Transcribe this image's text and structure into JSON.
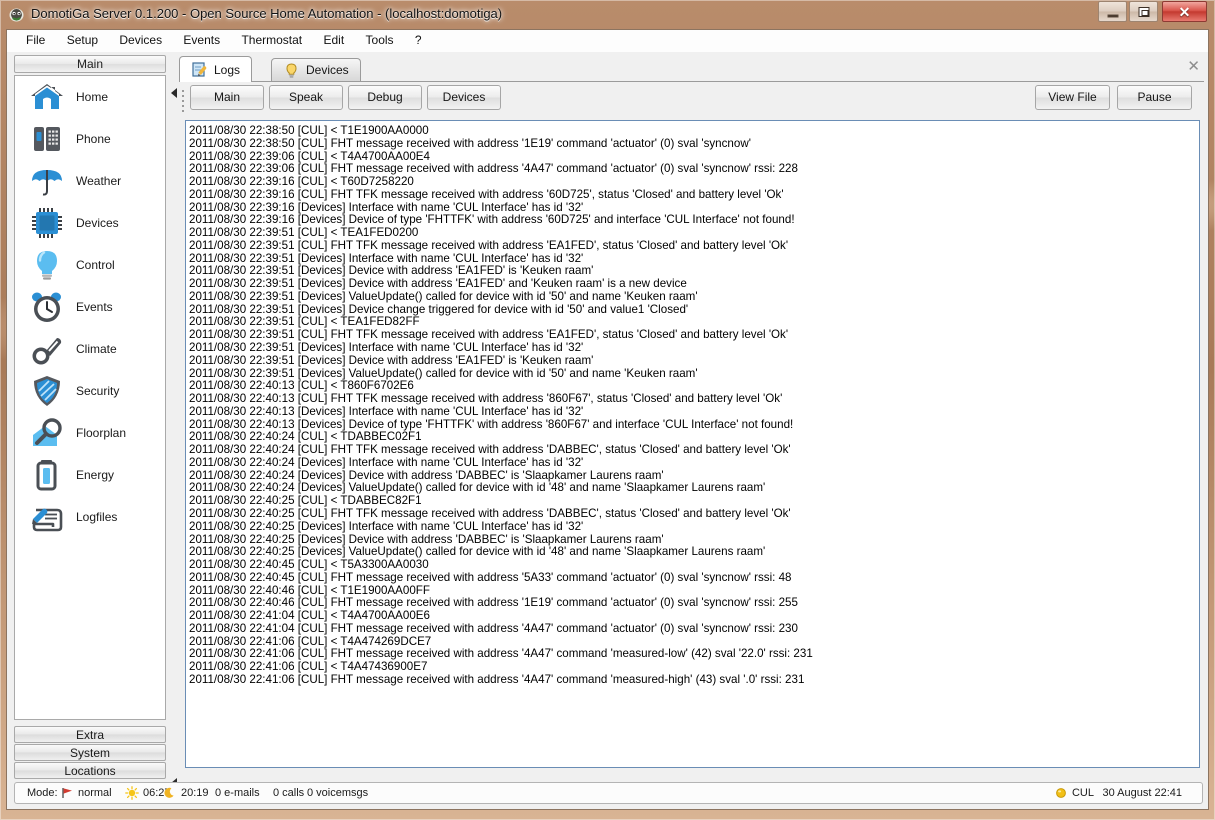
{
  "window": {
    "title": "DomotiGa Server 0.1.200 - Open Source Home Automation - (localhost:domotiga)",
    "icon": "domotiga-app-icon",
    "controls": {
      "minimize": "minimize",
      "maximize": "maximize",
      "close": "✕"
    },
    "accent_close": "#c33a30",
    "titlebar_color": "#a87a58"
  },
  "menubar": {
    "items": [
      {
        "label": "File"
      },
      {
        "label": "Setup"
      },
      {
        "label": "Devices"
      },
      {
        "label": "Events"
      },
      {
        "label": "Thermostat"
      },
      {
        "label": "Edit"
      },
      {
        "label": "Tools"
      },
      {
        "label": "?"
      }
    ]
  },
  "sidebar": {
    "header": "Main",
    "items": [
      {
        "label": "Home",
        "icon": "house-icon"
      },
      {
        "label": "Phone",
        "icon": "phone-icon"
      },
      {
        "label": "Weather",
        "icon": "umbrella-icon"
      },
      {
        "label": "Devices",
        "icon": "chip-icon"
      },
      {
        "label": "Control",
        "icon": "lightbulb-icon"
      },
      {
        "label": "Events",
        "icon": "alarm-clock-icon"
      },
      {
        "label": "Climate",
        "icon": "thermometer-icon"
      },
      {
        "label": "Security",
        "icon": "shield-icon"
      },
      {
        "label": "Floorplan",
        "icon": "house-magnifier-icon"
      },
      {
        "label": "Energy",
        "icon": "battery-icon"
      },
      {
        "label": "Logfiles",
        "icon": "scroll-pencil-icon"
      }
    ],
    "footer_buttons": [
      {
        "label": "Extra"
      },
      {
        "label": "System"
      },
      {
        "label": "Locations"
      }
    ]
  },
  "main": {
    "tabs": [
      {
        "label": "Logs",
        "icon": "notepad-pencil-icon",
        "active": true
      },
      {
        "label": "Devices",
        "icon": "lightbulb-icon",
        "active": false
      }
    ],
    "close_tab_label": "✕",
    "toolbar": {
      "left_buttons": [
        {
          "label": "Main"
        },
        {
          "label": "Speak"
        },
        {
          "label": "Debug"
        },
        {
          "label": "Devices"
        }
      ],
      "right_buttons": [
        {
          "label": "View File"
        },
        {
          "label": "Pause"
        }
      ]
    },
    "log_lines": [
      "2011/08/30 22:38:50 [CUL] < T1E1900AA0000",
      "2011/08/30 22:38:50 [CUL] FHT message received with address '1E19' command 'actuator' (0) sval 'syncnow'",
      "2011/08/30 22:39:06 [CUL] < T4A4700AA00E4",
      "2011/08/30 22:39:06 [CUL] FHT message received with address '4A47' command 'actuator' (0) sval 'syncnow' rssi: 228",
      "2011/08/30 22:39:16 [CUL] < T60D7258220",
      "2011/08/30 22:39:16 [CUL] FHT TFK message received with address '60D725', status 'Closed' and battery level 'Ok'",
      "2011/08/30 22:39:16 [Devices] Interface with name 'CUL Interface' has id '32'",
      "2011/08/30 22:39:16 [Devices] Device of type 'FHTTFK' with address '60D725' and interface 'CUL Interface' not found!",
      "2011/08/30 22:39:51 [CUL] < TEA1FED0200",
      "2011/08/30 22:39:51 [CUL] FHT TFK message received with address 'EA1FED', status 'Closed' and battery level 'Ok'",
      "2011/08/30 22:39:51 [Devices] Interface with name 'CUL Interface' has id '32'",
      "2011/08/30 22:39:51 [Devices] Device with address 'EA1FED' is 'Keuken raam'",
      "2011/08/30 22:39:51 [Devices] Device with address 'EA1FED' and 'Keuken raam' is a new device",
      "2011/08/30 22:39:51 [Devices] ValueUpdate() called for device with id '50' and name 'Keuken raam'",
      "2011/08/30 22:39:51 [Devices] Device change triggered for device with id '50' and value1 'Closed'",
      "2011/08/30 22:39:51 [CUL] < TEA1FED82FF",
      "2011/08/30 22:39:51 [CUL] FHT TFK message received with address 'EA1FED', status 'Closed' and battery level 'Ok'",
      "2011/08/30 22:39:51 [Devices] Interface with name 'CUL Interface' has id '32'",
      "2011/08/30 22:39:51 [Devices] Device with address 'EA1FED' is 'Keuken raam'",
      "2011/08/30 22:39:51 [Devices] ValueUpdate() called for device with id '50' and name 'Keuken raam'",
      "2011/08/30 22:40:13 [CUL] < T860F6702E6",
      "2011/08/30 22:40:13 [CUL] FHT TFK message received with address '860F67', status 'Closed' and battery level 'Ok'",
      "2011/08/30 22:40:13 [Devices] Interface with name 'CUL Interface' has id '32'",
      "2011/08/30 22:40:13 [Devices] Device of type 'FHTTFK' with address '860F67' and interface 'CUL Interface' not found!",
      "2011/08/30 22:40:24 [CUL] < TDABBEC02F1",
      "2011/08/30 22:40:24 [CUL] FHT TFK message received with address 'DABBEC', status 'Closed' and battery level 'Ok'",
      "2011/08/30 22:40:24 [Devices] Interface with name 'CUL Interface' has id '32'",
      "2011/08/30 22:40:24 [Devices] Device with address 'DABBEC' is 'Slaapkamer Laurens raam'",
      "2011/08/30 22:40:24 [Devices] ValueUpdate() called for device with id '48' and name 'Slaapkamer Laurens raam'",
      "2011/08/30 22:40:25 [CUL] < TDABBEC82F1",
      "2011/08/30 22:40:25 [CUL] FHT TFK message received with address 'DABBEC', status 'Closed' and battery level 'Ok'",
      "2011/08/30 22:40:25 [Devices] Interface with name 'CUL Interface' has id '32'",
      "2011/08/30 22:40:25 [Devices] Device with address 'DABBEC' is 'Slaapkamer Laurens raam'",
      "2011/08/30 22:40:25 [Devices] ValueUpdate() called for device with id '48' and name 'Slaapkamer Laurens raam'",
      "2011/08/30 22:40:45 [CUL] < T5A3300AA0030",
      "2011/08/30 22:40:45 [CUL] FHT message received with address '5A33' command 'actuator' (0) sval 'syncnow' rssi: 48",
      "2011/08/30 22:40:46 [CUL] < T1E1900AA00FF",
      "2011/08/30 22:40:46 [CUL] FHT message received with address '1E19' command 'actuator' (0) sval 'syncnow' rssi: 255",
      "2011/08/30 22:41:04 [CUL] < T4A4700AA00E6",
      "2011/08/30 22:41:04 [CUL] FHT message received with address '4A47' command 'actuator' (0) sval 'syncnow' rssi: 230",
      "2011/08/30 22:41:06 [CUL] < T4A474269DCE7",
      "2011/08/30 22:41:06 [CUL] FHT message received with address '4A47' command 'measured-low' (42) sval '22.0' rssi: 231",
      "2011/08/30 22:41:06 [CUL] < T4A47436900E7",
      "2011/08/30 22:41:06 [CUL] FHT message received with address '4A47' command 'measured-high' (43) sval '.0' rssi: 231"
    ]
  },
  "statusbar": {
    "mode_label": "Mode:",
    "mode_value": "normal",
    "mode_icon": "red-flag-icon",
    "sunrise_icon": "sun-icon",
    "sunrise": "06:27",
    "sunset_icon": "moon-icon",
    "sunset": "20:19",
    "emails": "0 e-mails",
    "calls": "0 calls",
    "voicemsgs": "0 voicemsgs",
    "interface_icon": "status-dot-icon",
    "interface_name": "CUL",
    "interface_status_color": "#f2c017",
    "datetime": "30 August 22:41"
  }
}
